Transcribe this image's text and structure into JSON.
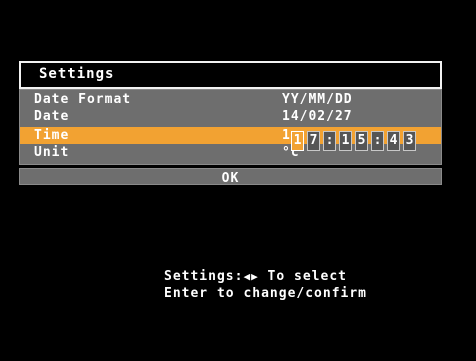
{
  "dialog": {
    "title": "Settings",
    "rows": [
      {
        "label": "Date Format",
        "value": "YY/MM/DD"
      },
      {
        "label": "Date",
        "value": "14/02/27"
      },
      {
        "label": "Time",
        "value": "1"
      },
      {
        "label": "Unit",
        "value": "°c"
      }
    ],
    "time_digits": [
      "1",
      "7",
      ":",
      "1",
      "5",
      ":",
      "4",
      "3"
    ],
    "ok_label": "OK"
  },
  "help": {
    "line1_prefix": "Settings:",
    "line1_arrows": "◀▶",
    "line1_suffix": " To select",
    "line2": "Enter to change/confirm"
  },
  "colors": {
    "selected_row": "#f2a232",
    "panel_bg": "#6e6e6e",
    "screen_bg": "#000000"
  }
}
